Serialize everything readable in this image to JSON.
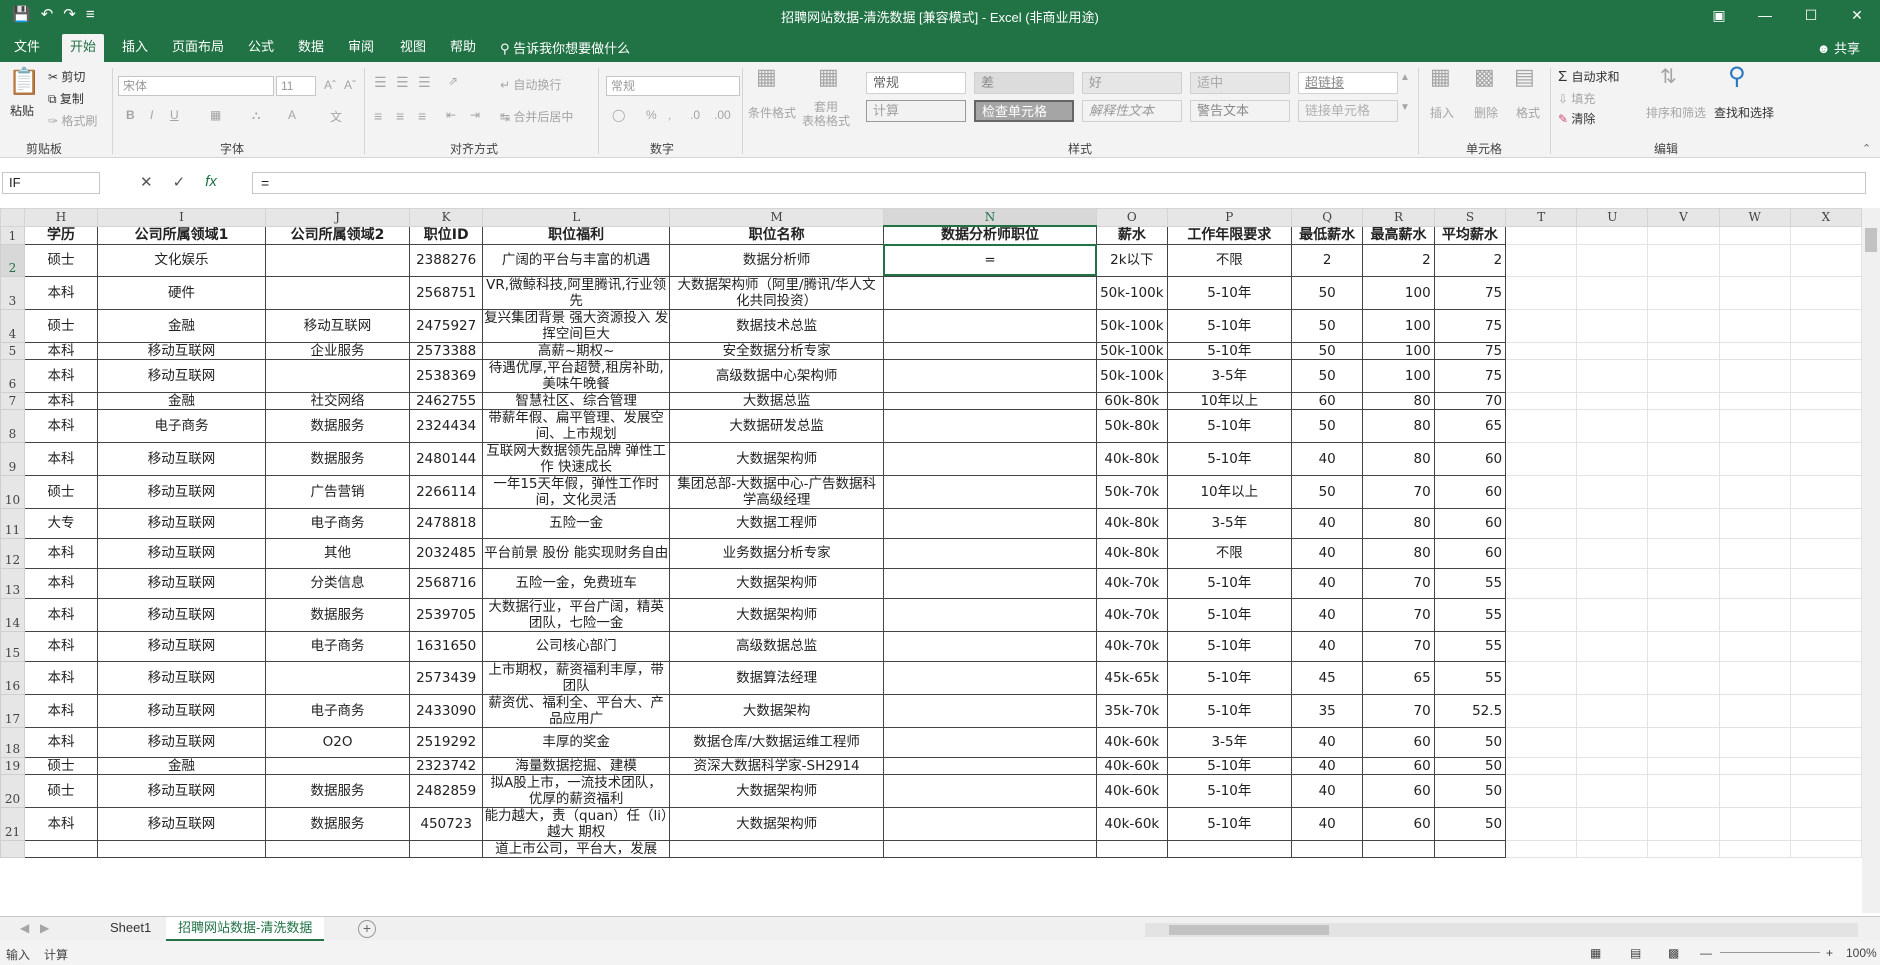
{
  "window": {
    "title": "招聘网站数据-清洗数据  [兼容模式]  -  Excel (非商业用途)",
    "quick_access": [
      "save-icon",
      "undo-icon",
      "redo-icon",
      "customize-icon"
    ]
  },
  "tabs": [
    "文件",
    "开始",
    "插入",
    "页面布局",
    "公式",
    "数据",
    "审阅",
    "视图",
    "帮助"
  ],
  "active_tab": "开始",
  "tell_me": "告诉我你想要做什么",
  "share": "共享",
  "ribbon": {
    "clipboard": {
      "label": "剪贴板",
      "paste": "粘贴",
      "cut": "剪切",
      "copy": "复制",
      "format_painter": "格式刷"
    },
    "font": {
      "label": "字体",
      "font_name": "宋体",
      "font_size": "11",
      "bold": "B",
      "italic": "I",
      "underline": "U"
    },
    "alignment": {
      "label": "对齐方式",
      "wrap": "自动换行",
      "merge": "合并后居中"
    },
    "number": {
      "label": "数字",
      "format": "常规",
      "percent": "%"
    },
    "styles": {
      "label": "样式",
      "cond_format": "条件格式",
      "table_format": "套用\n表格格式",
      "cells": [
        "常规",
        "差",
        "好",
        "适中",
        "超链接",
        "计算",
        "检查单元格",
        "解释性文本",
        "警告文本",
        "链接单元格"
      ]
    },
    "cells": {
      "label": "单元格",
      "insert": "插入",
      "delete": "删除",
      "format": "格式"
    },
    "editing": {
      "label": "编辑",
      "autosum": "自动求和",
      "fill": "填充",
      "clear": "清除",
      "sort": "排序和筛选",
      "find": "查找和选择"
    }
  },
  "formula_bar": {
    "name_box": "IF",
    "formula": "="
  },
  "columns": [
    "H",
    "I",
    "J",
    "K",
    "L",
    "M",
    "N",
    "O",
    "P",
    "Q",
    "R",
    "S",
    "T",
    "U",
    "V",
    "W",
    "X"
  ],
  "selected_column": "N",
  "rows": [
    {
      "n": "1",
      "cells": [
        "学历",
        "公司所属领域1",
        "公司所属领域2",
        "职位ID",
        "职位福利",
        "职位名称",
        "数据分析师职位",
        "薪水",
        "工作年限要求",
        "最低薪水",
        "最高薪水",
        "平均薪水"
      ]
    },
    {
      "n": "2",
      "cells": [
        "硕士",
        "文化娱乐",
        "",
        "2388276",
        "广阔的平台与丰富的机遇",
        "数据分析师",
        "=",
        "2k以下",
        "不限",
        "2",
        "2",
        "2"
      ]
    },
    {
      "n": "3",
      "cells": [
        "本科",
        "硬件",
        "",
        "2568751",
        "VR,微鲸科技,阿里腾讯,行业领先",
        "大数据架构师（阿里/腾讯/华人文化共同投资）",
        "",
        "50k-100k",
        "5-10年",
        "50",
        "100",
        "75"
      ]
    },
    {
      "n": "4",
      "cells": [
        "硕士",
        "金融",
        "移动互联网",
        "2475927",
        "复兴集团背景 强大资源投入 发挥空间巨大",
        "数据技术总监",
        "",
        "50k-100k",
        "5-10年",
        "50",
        "100",
        "75"
      ]
    },
    {
      "n": "5",
      "cells": [
        "本科",
        "移动互联网",
        "企业服务",
        "2573388",
        "高薪~期权~",
        "安全数据分析专家",
        "",
        "50k-100k",
        "5-10年",
        "50",
        "100",
        "75"
      ]
    },
    {
      "n": "6",
      "cells": [
        "本科",
        "移动互联网",
        "",
        "2538369",
        "待遇优厚,平台超赞,租房补助,美味午晚餐",
        "高级数据中心架构师",
        "",
        "50k-100k",
        "3-5年",
        "50",
        "100",
        "75"
      ]
    },
    {
      "n": "7",
      "cells": [
        "本科",
        "金融",
        "社交网络",
        "2462755",
        "智慧社区、综合管理",
        "大数据总监",
        "",
        "60k-80k",
        "10年以上",
        "60",
        "80",
        "70"
      ]
    },
    {
      "n": "8",
      "cells": [
        "本科",
        "电子商务",
        "数据服务",
        "2324434",
        "带薪年假、扁平管理、发展空间、上市规划",
        "大数据研发总监",
        "",
        "50k-80k",
        "5-10年",
        "50",
        "80",
        "65"
      ]
    },
    {
      "n": "9",
      "cells": [
        "本科",
        "移动互联网",
        "数据服务",
        "2480144",
        "互联网大数据领先品牌 弹性工作 快速成长",
        "大数据架构师",
        "",
        "40k-80k",
        "5-10年",
        "40",
        "80",
        "60"
      ]
    },
    {
      "n": "10",
      "cells": [
        "硕士",
        "移动互联网",
        "广告营销",
        "2266114",
        "一年15天年假，弹性工作时间，文化灵活",
        "集团总部-大数据中心-广告数据科学高级经理",
        "",
        "50k-70k",
        "10年以上",
        "50",
        "70",
        "60"
      ]
    },
    {
      "n": "11",
      "cells": [
        "大专",
        "移动互联网",
        "电子商务",
        "2478818",
        "五险一金",
        "大数据工程师",
        "",
        "40k-80k",
        "3-5年",
        "40",
        "80",
        "60"
      ]
    },
    {
      "n": "12",
      "cells": [
        "本科",
        "移动互联网",
        "其他",
        "2032485",
        "平台前景 股份 能实现财务自由",
        "业务数据分析专家",
        "",
        "40k-80k",
        "不限",
        "40",
        "80",
        "60"
      ]
    },
    {
      "n": "13",
      "cells": [
        "本科",
        "移动互联网",
        "分类信息",
        "2568716",
        "五险一金，免费班车",
        "大数据架构师",
        "",
        "40k-70k",
        "5-10年",
        "40",
        "70",
        "55"
      ]
    },
    {
      "n": "14",
      "cells": [
        "本科",
        "移动互联网",
        "数据服务",
        "2539705",
        "大数据行业，平台广阔，精英团队，七险一金",
        "大数据架构师",
        "",
        "40k-70k",
        "5-10年",
        "40",
        "70",
        "55"
      ]
    },
    {
      "n": "15",
      "cells": [
        "本科",
        "移动互联网",
        "电子商务",
        "1631650",
        "公司核心部门",
        "高级数据总监",
        "",
        "40k-70k",
        "5-10年",
        "40",
        "70",
        "55"
      ]
    },
    {
      "n": "16",
      "cells": [
        "本科",
        "移动互联网",
        "",
        "2573439",
        "上市期权，薪资福利丰厚，带团队",
        "数据算法经理",
        "",
        "45k-65k",
        "5-10年",
        "45",
        "65",
        "55"
      ]
    },
    {
      "n": "17",
      "cells": [
        "本科",
        "移动互联网",
        "电子商务",
        "2433090",
        "薪资优、福利全、平台大、产品应用广",
        "大数据架构",
        "",
        "35k-70k",
        "5-10年",
        "35",
        "70",
        "52.5"
      ]
    },
    {
      "n": "18",
      "cells": [
        "本科",
        "移动互联网",
        "O2O",
        "2519292",
        "丰厚的奖金",
        "数据仓库/大数据运维工程师",
        "",
        "40k-60k",
        "3-5年",
        "40",
        "60",
        "50"
      ]
    },
    {
      "n": "19",
      "cells": [
        "硕士",
        "金融",
        "",
        "2323742",
        "海量数据挖掘、建模",
        "资深大数据科学家-SH2914",
        "",
        "40k-60k",
        "5-10年",
        "40",
        "60",
        "50"
      ]
    },
    {
      "n": "20",
      "cells": [
        "硕士",
        "移动互联网",
        "数据服务",
        "2482859",
        "拟A股上市，一流技术团队，优厚的薪资福利",
        "大数据架构师",
        "",
        "40k-60k",
        "5-10年",
        "40",
        "60",
        "50"
      ]
    },
    {
      "n": "21",
      "cells": [
        "本科",
        "移动互联网",
        "数据服务",
        "450723",
        "能力越大，责（quan）任（li）越大 期权",
        "大数据架构师",
        "",
        "40k-60k",
        "5-10年",
        "40",
        "60",
        "50"
      ]
    },
    {
      "n": "",
      "cells": [
        "",
        "",
        "",
        "",
        "道上市公司，平台大，发展",
        "",
        "",
        "",
        "",
        "",
        "",
        ""
      ]
    }
  ],
  "sheets": [
    "Sheet1",
    "招聘网站数据-清洗数据"
  ],
  "active_sheet": "招聘网站数据-清洗数据",
  "status": {
    "mode": "输入",
    "calc": "计算",
    "zoom": "100%"
  },
  "colors": {
    "accent": "#217346",
    "ribbon_bg": "#f3f3f3"
  }
}
